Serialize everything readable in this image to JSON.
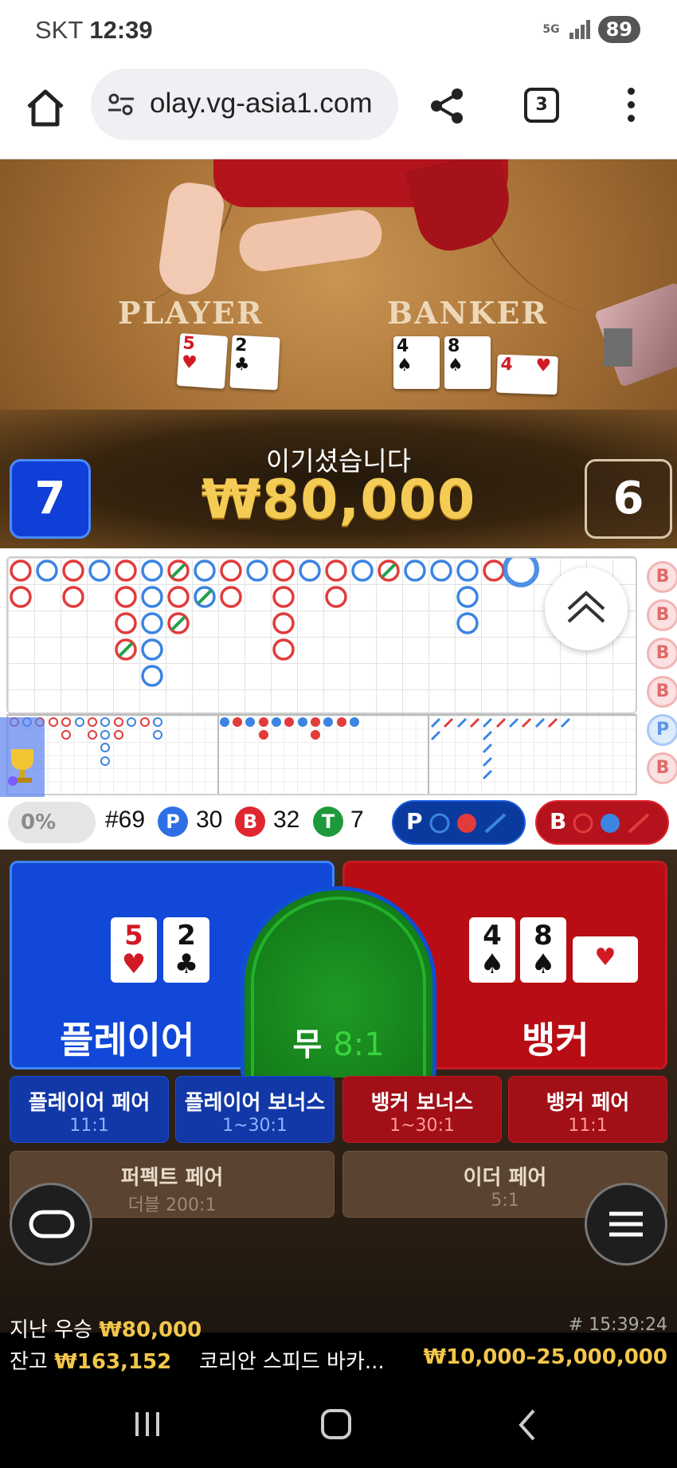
{
  "status": {
    "carrier": "SKT",
    "time": "12:39",
    "network": "5G",
    "battery": "89"
  },
  "browser": {
    "url": "olay.vg-asia1.com",
    "tab_count": "3"
  },
  "table": {
    "player_label": "PLAYER",
    "banker_label": "BANKER"
  },
  "result": {
    "title": "이기셨습니다",
    "amount": "₩80,000",
    "player_score": "7",
    "banker_score": "6"
  },
  "stats": {
    "percent": "0%",
    "round": "#69",
    "p_letter": "P",
    "p_count": "30",
    "b_letter": "B",
    "b_count": "32",
    "t_letter": "T",
    "t_count": "7",
    "pred_p": "P",
    "pred_b": "B"
  },
  "side_strip": [
    "B",
    "B",
    "B",
    "B",
    "P",
    "B"
  ],
  "bets": {
    "player_label": "플레이어",
    "tie_label": "무",
    "tie_odds": "8:1",
    "banker_label": "뱅커",
    "player_cards": [
      {
        "v": "5",
        "s": "♥",
        "color": "red"
      },
      {
        "v": "2",
        "s": "♣",
        "color": "black"
      }
    ],
    "banker_cards": [
      {
        "v": "4",
        "s": "♠",
        "color": "black"
      },
      {
        "v": "8",
        "s": "♠",
        "color": "black"
      },
      {
        "v": "4",
        "s": "♥",
        "color": "red"
      }
    ],
    "player_pair": {
      "name": "플레이어 페어",
      "odds": "11:1"
    },
    "player_bonus": {
      "name": "플레이어 보너스",
      "odds": "1~30:1"
    },
    "banker_bonus": {
      "name": "뱅커 보너스",
      "odds": "1~30:1"
    },
    "banker_pair": {
      "name": "뱅커 페어",
      "odds": "11:1"
    },
    "perfect_pair": {
      "name": "퍼펙트 페어",
      "odds": "더블 200:1"
    },
    "either_pair": {
      "name": "이더 페어",
      "odds": "5:1"
    }
  },
  "footer": {
    "last_win_label": "지난 우승",
    "last_win_amount": "₩80,000",
    "timestamp": "# 15:39:24",
    "balance_label": "잔고",
    "balance_amount": "₩163,152",
    "table_name": "코리안 스피드 바카...",
    "limits": "₩10,000–25,000,000"
  },
  "colors": {
    "player": "#1248d8",
    "banker": "#b80d14",
    "tie": "#1f9a25",
    "gold": "#f3c64a"
  }
}
